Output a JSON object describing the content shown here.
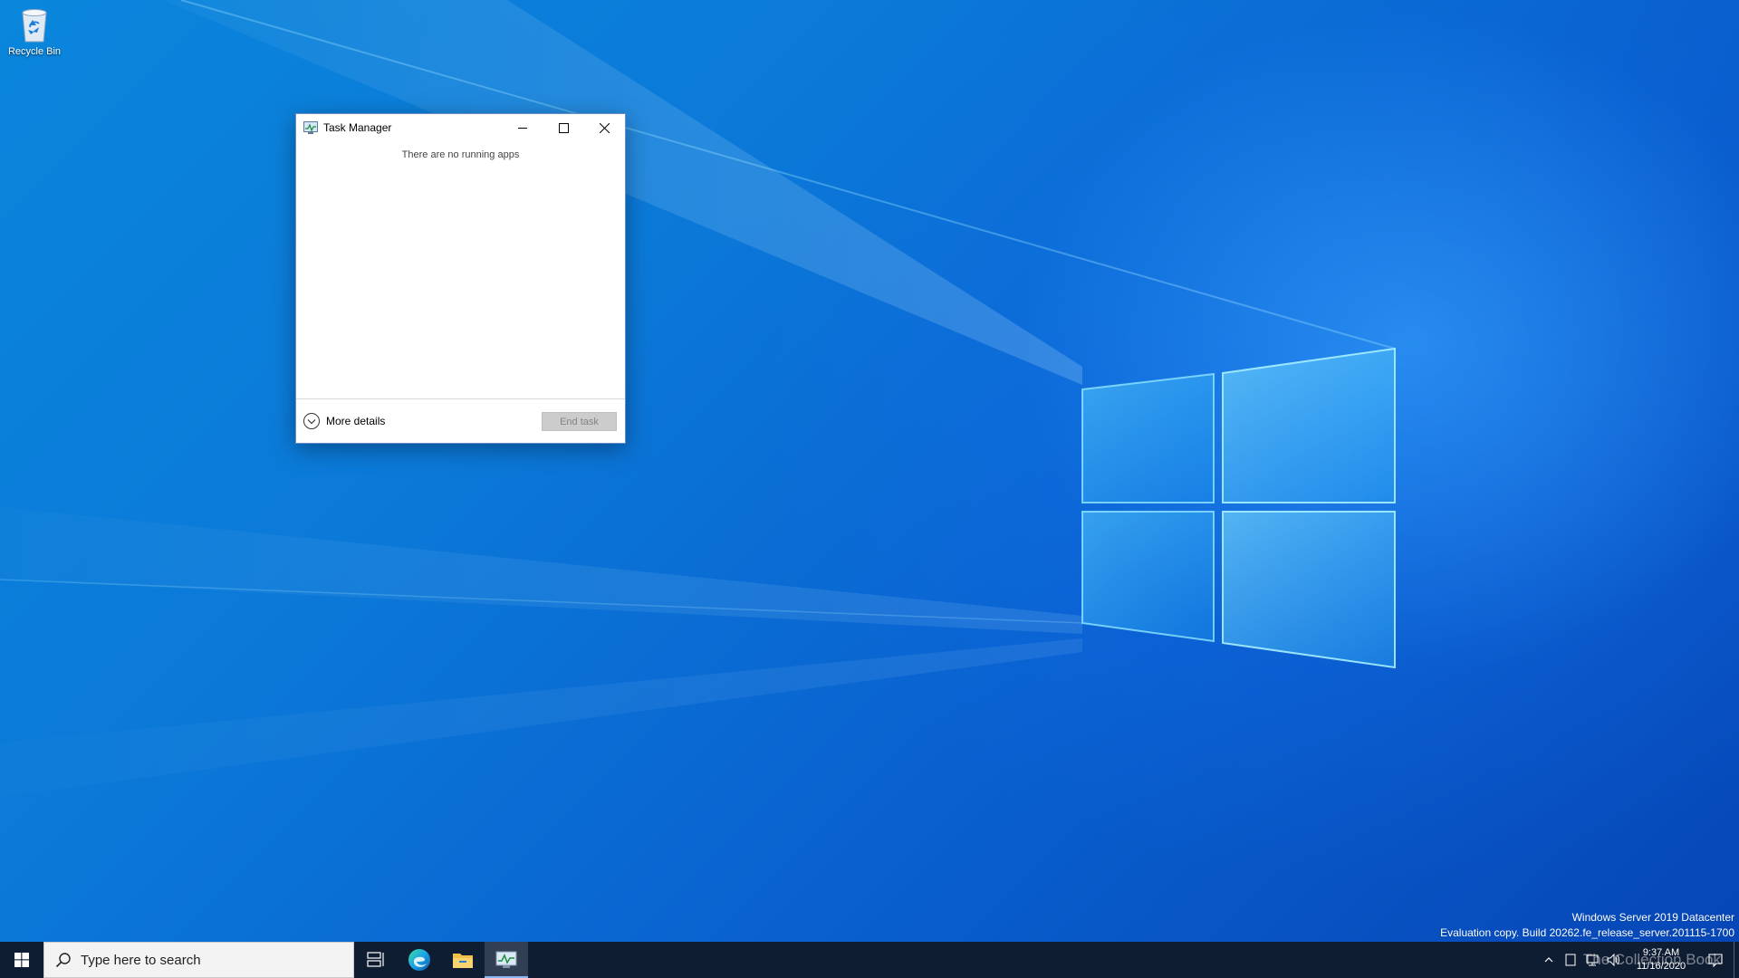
{
  "desktop": {
    "icons": [
      {
        "label": "Recycle Bin",
        "icon": "recycle-bin-icon"
      }
    ]
  },
  "task_manager": {
    "title": "Task Manager",
    "empty_message": "There are no running apps",
    "more_details_label": "More details",
    "end_task_label": "End task",
    "end_task_enabled": false
  },
  "watermark": {
    "line1": "Windows Server 2019 Datacenter",
    "line2": "Evaluation copy. Build 20262.fe_release_server.201115-1700"
  },
  "taskbar": {
    "search_placeholder": "Type here to search",
    "pinned": [
      {
        "name": "task-view-icon",
        "active": false
      },
      {
        "name": "edge-icon",
        "active": false
      },
      {
        "name": "file-explorer-icon",
        "active": false
      },
      {
        "name": "task-manager-icon",
        "active": true
      }
    ],
    "clock": {
      "time": "9:37 AM",
      "date": "11/16/2020"
    },
    "overlay_text": "The Collection Book"
  },
  "colors": {
    "taskbar_bg": "#0f1d33",
    "accent": "#0078d7",
    "window_border": "#6a8fc8",
    "disabled_button": "#cccccc"
  }
}
